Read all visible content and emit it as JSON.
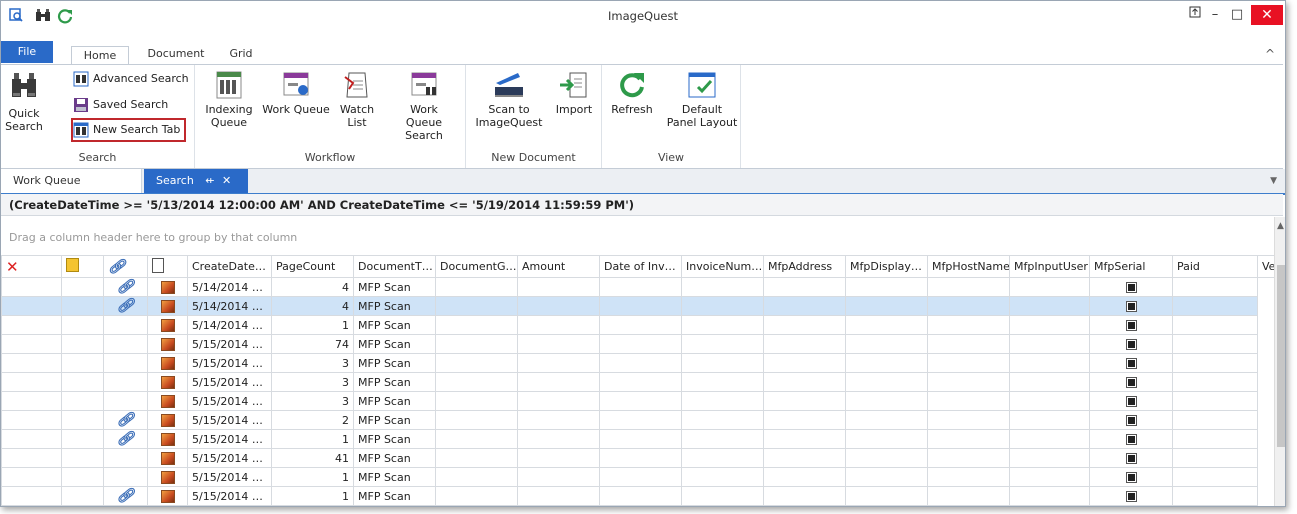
{
  "window": {
    "title": "ImageQuest",
    "controls": {
      "restore_icon": "pin-window-icon",
      "minimize": "–",
      "maximize": "□",
      "close": "✕"
    }
  },
  "ribbon_tabs": [
    "File",
    "Home",
    "Document",
    "Grid"
  ],
  "ribbon_collapse": "^",
  "ribbon": {
    "search": {
      "label": "Search",
      "quick_search_line1": "Quick",
      "quick_search_line2": "Search",
      "advanced_search": "Advanced Search",
      "saved_search": "Saved Search",
      "new_search_tab": "New Search Tab"
    },
    "workflow": {
      "label": "Workflow",
      "indexing_queue_line1": "Indexing",
      "indexing_queue_line2": "Queue",
      "work_queue": "Work Queue",
      "watch_list_line1": "Watch",
      "watch_list_line2": "List",
      "work_queue_search_line1": "Work Queue",
      "work_queue_search_line2": "Search"
    },
    "new_document": {
      "label": "New Document",
      "scan_line1": "Scan to",
      "scan_line2": "ImageQuest",
      "import": "Import"
    },
    "view": {
      "label": "View",
      "refresh": "Refresh",
      "default_layout_line1": "Default",
      "default_layout_line2": "Panel Layout"
    }
  },
  "doc_tabs": {
    "work_queue": "Work Queue",
    "search": "Search",
    "search_pin": "⇷",
    "search_close": "✕"
  },
  "filter": "(CreateDateTime >= '5/13/2014 12:00:00 AM' AND CreateDateTime <= '5/19/2014 11:59:59 PM')",
  "group_panel_hint": "Drag a column header here to group by that column",
  "grid": {
    "columns": [
      "CreateDate…",
      "PageCount",
      "DocumentT…",
      "DocumentG…",
      "Amount",
      "Date of Inv…",
      "InvoiceNum…",
      "MfpAddress",
      "MfpDisplay…",
      "MfpHostName",
      "MfpInputUser",
      "MfpSerial",
      "Paid",
      "Vend"
    ],
    "rows": [
      {
        "link": true,
        "date": "5/14/2014 …",
        "pages": "4",
        "type": "MFP Scan",
        "selected": false
      },
      {
        "link": true,
        "date": "5/14/2014 …",
        "pages": "4",
        "type": "MFP Scan",
        "selected": true
      },
      {
        "link": false,
        "date": "5/14/2014 …",
        "pages": "1",
        "type": "MFP Scan",
        "selected": false
      },
      {
        "link": false,
        "date": "5/15/2014 …",
        "pages": "74",
        "type": "MFP Scan",
        "selected": false
      },
      {
        "link": false,
        "date": "5/15/2014 …",
        "pages": "3",
        "type": "MFP Scan",
        "selected": false
      },
      {
        "link": false,
        "date": "5/15/2014 …",
        "pages": "3",
        "type": "MFP Scan",
        "selected": false
      },
      {
        "link": false,
        "date": "5/15/2014 …",
        "pages": "3",
        "type": "MFP Scan",
        "selected": false
      },
      {
        "link": true,
        "date": "5/15/2014 …",
        "pages": "2",
        "type": "MFP Scan",
        "selected": false
      },
      {
        "link": true,
        "date": "5/15/2014 …",
        "pages": "1",
        "type": "MFP Scan",
        "selected": false
      },
      {
        "link": false,
        "date": "5/15/2014 …",
        "pages": "41",
        "type": "MFP Scan",
        "selected": false
      },
      {
        "link": false,
        "date": "5/15/2014 …",
        "pages": "1",
        "type": "MFP Scan",
        "selected": false
      },
      {
        "link": true,
        "date": "5/15/2014 …",
        "pages": "1",
        "type": "MFP Scan",
        "selected": false
      }
    ]
  },
  "colors": {
    "accent": "#2a6ac8",
    "close": "#e81123",
    "selection": "#cfe3f7",
    "highlight_box": "#c0282c"
  }
}
